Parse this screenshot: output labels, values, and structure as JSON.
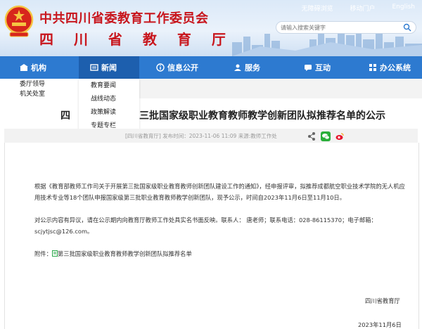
{
  "header": {
    "org": "中共四川省委教育工作委员会",
    "name": "四 川 省 教 育 厅",
    "toplinks": [
      "无障碍浏览",
      "移动门户",
      "English"
    ],
    "search_placeholder": "请输入搜索关键字"
  },
  "nav": [
    {
      "label": "机构",
      "icon": "institution-icon"
    },
    {
      "label": "新闻",
      "icon": "news-icon"
    },
    {
      "label": "信息公开",
      "icon": "info-icon"
    },
    {
      "label": "服务",
      "icon": "service-icon"
    },
    {
      "label": "互动",
      "icon": "interact-icon"
    },
    {
      "label": "办公系统",
      "icon": "office-icon"
    }
  ],
  "dropdown_institution": [
    "委厅领导",
    "机关处室"
  ],
  "dropdown_news": [
    "教育要闻",
    "战线动态",
    "政策解读",
    "专题专栏"
  ],
  "article": {
    "title_prefix": "四",
    "title_main": "三批国家级职业教育教师教学创新团队拟推荐名单的公示",
    "meta": "[四川省教育厅]   发布时间：2023-11-06 11:09   来源:教师工作处",
    "para1": "根据《教育部教师工作司关于开展第三批国家级职业教育教师创新团队建设工作的通知》，经申报评审，拟推荐成都航空职业技术学院的无人机应用技术专业等18个团队申报国家级第三批职业教育教师教学创新团队，现予公示，时间自2023年11月6日至11月10日。",
    "para2": "对公示内容有异议，请在公示期内向教育厅教师工作处具实名书面反映。联系人：  唐老师；联系电话：028-86115370；电子邮箱：scjytjsc@126.com。",
    "attachment": "附件：",
    "attachment_link": "第三批国家级职业教育教师教学创新团队拟推荐名单",
    "signature": "四川省教育厅",
    "date": "2023年11月6日"
  },
  "colors": {
    "nav": "#2d7ad0",
    "title_red": "#c8161d"
  }
}
